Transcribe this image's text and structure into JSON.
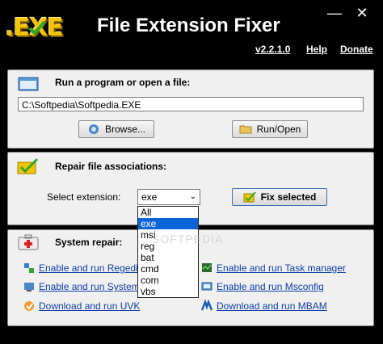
{
  "window": {
    "logo_text": ".EXE",
    "title": "File Extension Fixer",
    "minimize_glyph": "—",
    "close_glyph": "✕",
    "version_link": "v2.2.1.0",
    "help_link": "Help",
    "donate_link": "Donate"
  },
  "run_panel": {
    "label": "Run a program or open a file:",
    "path_value": "C:\\Softpedia\\Softpedia.EXE",
    "browse_label": "Browse...",
    "run_label": "Run/Open"
  },
  "repair_panel": {
    "label": "Repair file associations:",
    "select_label": "Select extension:",
    "selected_extension": "exe",
    "fix_label": "Fix selected",
    "extension_options": [
      "All",
      "exe",
      "msi",
      "reg",
      "bat",
      "cmd",
      "com",
      "vbs"
    ]
  },
  "system_panel": {
    "label": "System repair:",
    "links_left": [
      "Enable and run Regedit",
      "Enable and run System",
      "Download and run UVK"
    ],
    "links_right": [
      "Enable and run Task manager",
      "Enable and run Msconfig",
      "Download and run MBAM"
    ]
  },
  "watermark": "SOFTPEDIA",
  "colors": {
    "title_bg": "#000000",
    "panel_bg": "#f0f0f0",
    "link": "#0b3fa8",
    "selection": "#0a64d8",
    "logo": "#f4c400"
  }
}
